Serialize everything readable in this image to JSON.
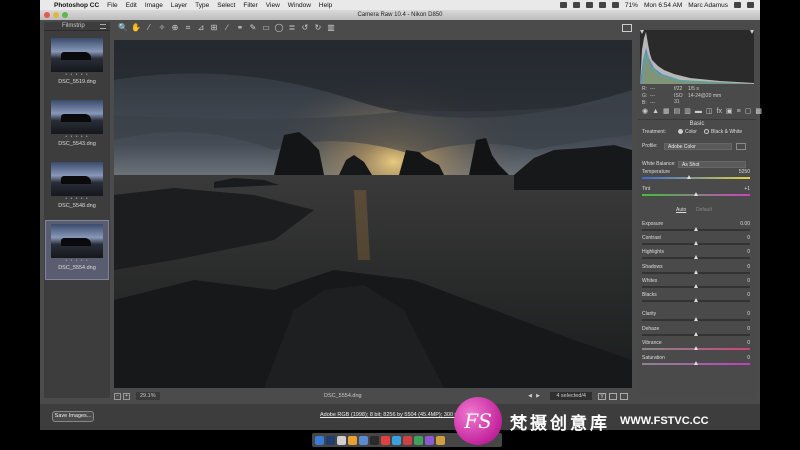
{
  "menubar": {
    "apple_glyph": "",
    "items": [
      "Photoshop CC",
      "File",
      "Edit",
      "Image",
      "Layer",
      "Type",
      "Select",
      "Filter",
      "View",
      "Window",
      "Help"
    ],
    "battery": "71%",
    "clock": "Mon 6:54 AM",
    "user": "Marc Adamus"
  },
  "window": {
    "title": "Camera Raw 10.4 - Nikon D850"
  },
  "filmstrip": {
    "title": "Filmstrip",
    "items": [
      {
        "label": "DSC_5519.dng",
        "stars": "• • • • •",
        "selected": false
      },
      {
        "label": "DSC_5543.dng",
        "stars": "• • • • •",
        "selected": false
      },
      {
        "label": "DSC_5548.dng",
        "stars": "• • • • •",
        "selected": false
      },
      {
        "label": "DSC_5554.dng",
        "stars": "• • • • •",
        "selected": true
      }
    ]
  },
  "toolbar": {
    "tools": [
      {
        "name": "zoom-tool-icon",
        "glyph": "🔍"
      },
      {
        "name": "hand-tool-icon",
        "glyph": "✋"
      },
      {
        "name": "white-balance-tool-icon",
        "glyph": "⁄"
      },
      {
        "name": "color-sampler-tool-icon",
        "glyph": "✧"
      },
      {
        "name": "targeted-adjustment-tool-icon",
        "glyph": "⊕"
      },
      {
        "name": "crop-tool-icon",
        "glyph": "⌗"
      },
      {
        "name": "straighten-tool-icon",
        "glyph": "⊿"
      },
      {
        "name": "transform-tool-icon",
        "glyph": "⊞"
      },
      {
        "name": "spot-removal-tool-icon",
        "glyph": "∕"
      },
      {
        "name": "red-eye-tool-icon",
        "glyph": "⚭"
      },
      {
        "name": "adjustment-brush-icon",
        "glyph": "✎"
      },
      {
        "name": "graduated-filter-icon",
        "glyph": "▭"
      },
      {
        "name": "radial-filter-icon",
        "glyph": "◯"
      },
      {
        "name": "preferences-icon",
        "glyph": "≣"
      },
      {
        "name": "rotate-left-icon",
        "glyph": "↺"
      },
      {
        "name": "rotate-right-icon",
        "glyph": "↻"
      },
      {
        "name": "trash-icon",
        "glyph": "▥"
      }
    ]
  },
  "preview_footer": {
    "minus": "−",
    "plus": "+",
    "zoom": "29.1%",
    "filename": "DSC_5554.dng",
    "prev_arrow": "◀",
    "next_arrow": "▶",
    "selected_count": "4 selected/4",
    "view_y": "Y"
  },
  "readout": {
    "r_label": "R:",
    "r_val": "---",
    "g_label": "G:",
    "g_val": "---",
    "b_label": "B:",
    "b_val": "---",
    "aperture": "f/22",
    "shutter": "1/5 s",
    "iso": "ISO 31",
    "lens": "14-24@20 mm"
  },
  "panel": {
    "tab_glyphs": [
      "◉",
      "▲",
      "▦",
      "▤",
      "▥",
      "▬",
      "◫",
      "fx",
      "▣",
      "≡",
      "▢",
      "▩"
    ],
    "section_title": "Basic",
    "treatment_label": "Treatment:",
    "treatment_color": "Color",
    "treatment_bw": "Black & White",
    "profile_label": "Profile:",
    "profile_value": "Adobe Color",
    "white_balance_label": "White Balance:",
    "white_balance_value": "As Shot",
    "auto_label": "Auto",
    "default_label": "Default",
    "sliders": [
      {
        "label": "Temperature",
        "value": "5250",
        "pos": 0.44
      },
      {
        "label": "Tint",
        "value": "+1",
        "pos": 0.5
      },
      {
        "label": "Exposure",
        "value": "0.00",
        "pos": 0.5
      },
      {
        "label": "Contrast",
        "value": "0",
        "pos": 0.5
      },
      {
        "label": "Highlights",
        "value": "0",
        "pos": 0.5
      },
      {
        "label": "Shadows",
        "value": "0",
        "pos": 0.5
      },
      {
        "label": "Whites",
        "value": "0",
        "pos": 0.5
      },
      {
        "label": "Blacks",
        "value": "0",
        "pos": 0.5
      },
      {
        "label": "Clarity",
        "value": "0",
        "pos": 0.5
      },
      {
        "label": "Dehaze",
        "value": "0",
        "pos": 0.5
      },
      {
        "label": "Vibrance",
        "value": "0",
        "pos": 0.5
      },
      {
        "label": "Saturation",
        "value": "0",
        "pos": 0.5
      }
    ]
  },
  "bottombar": {
    "save_label": "Save Images...",
    "workflow_text": "Adobe RGB (1998); 8 bit; 8256 by 5504 (45.4MP); 300 p"
  },
  "watermark": {
    "badge": "FS",
    "chinese": "梵摄创意库",
    "url": "WWW.FSTVC.CC"
  },
  "colors": {
    "window_bg": "#4b4b4b",
    "panel_bg": "#4a4a4a",
    "selected_thumb": "#5a5d70",
    "watermark_pink": "#d62fa6"
  }
}
